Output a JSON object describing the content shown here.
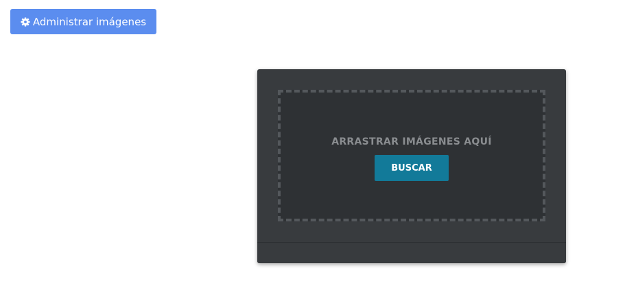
{
  "toolbar": {
    "manage_images_label": "Administrar imágenes",
    "manage_images_icon": "gear-icon"
  },
  "uploader": {
    "drop_text": "ARRASTRAR IMÁGENES AQUÍ",
    "search_label": "BUSCAR"
  },
  "colors": {
    "primary_button": "#5b8def",
    "panel_background": "#383b3e",
    "dropzone_background": "#2e3134",
    "search_button": "#127a99"
  }
}
